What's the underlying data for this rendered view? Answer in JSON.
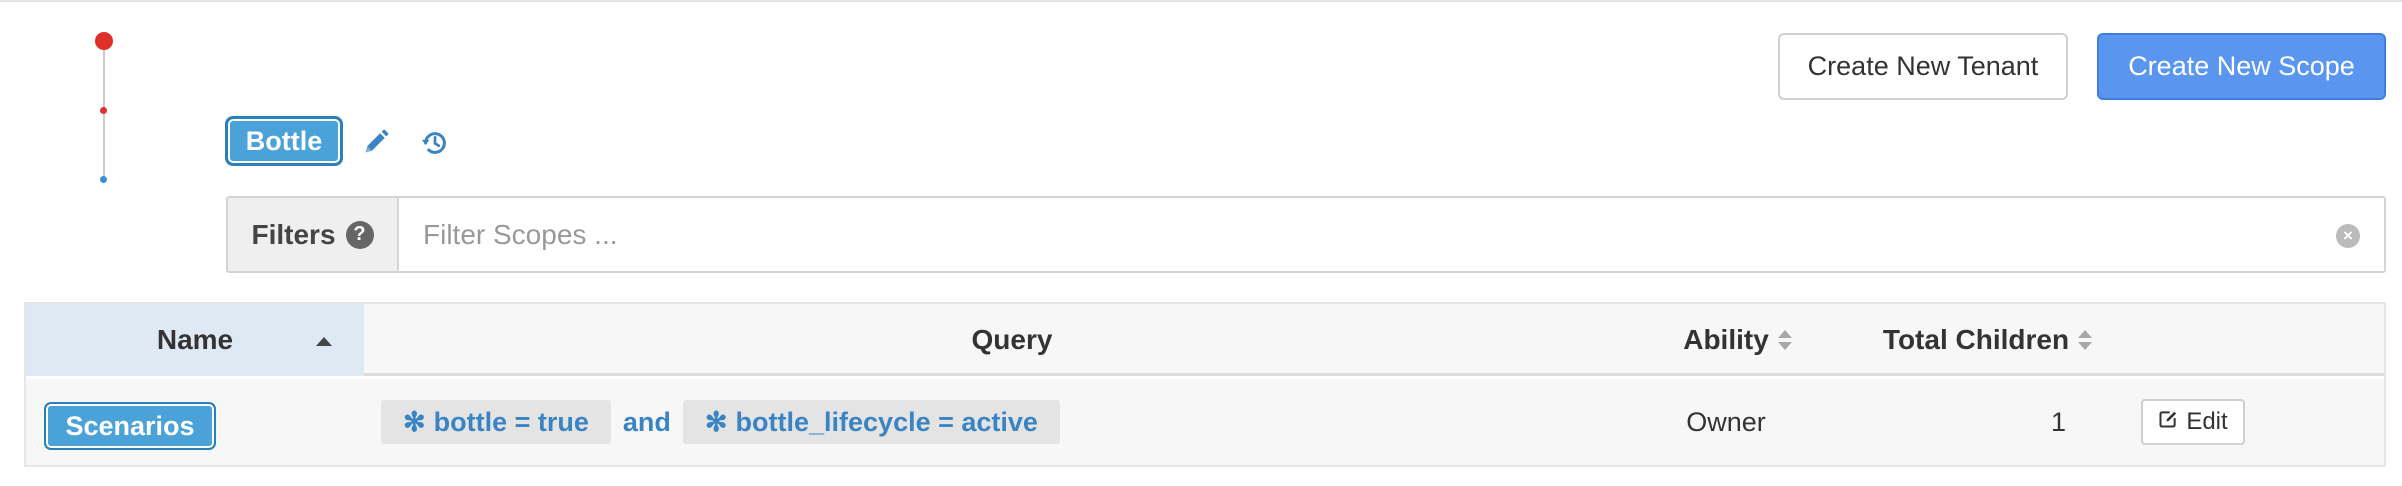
{
  "header": {
    "create_tenant_label": "Create New Tenant",
    "create_scope_label": "Create New Scope"
  },
  "scope": {
    "current_label": "Bottle",
    "edit_icon": "pencil-icon",
    "history_icon": "history-icon"
  },
  "filters": {
    "label": "Filters",
    "help_icon_glyph": "?",
    "placeholder": "Filter Scopes ...",
    "value": "",
    "clear_icon_glyph": "×"
  },
  "table": {
    "columns": {
      "name": "Name",
      "query": "Query",
      "ability": "Ability",
      "total_children": "Total Children"
    },
    "sort": {
      "column": "name",
      "direction": "asc"
    },
    "rows": [
      {
        "name": "Scenarios",
        "query": {
          "term1": "bottle = true",
          "joiner": "and",
          "term2": "bottle_lifecycle = active",
          "term_glyph": "✻"
        },
        "ability": "Owner",
        "total_children": "1",
        "edit_label": "Edit"
      }
    ]
  },
  "colors": {
    "primary": "#5a96f0",
    "chip": "#4aa2d8",
    "query_text": "#3b84c4",
    "tree_root": "#e0302b",
    "tree_current": "#3b8fd0"
  }
}
